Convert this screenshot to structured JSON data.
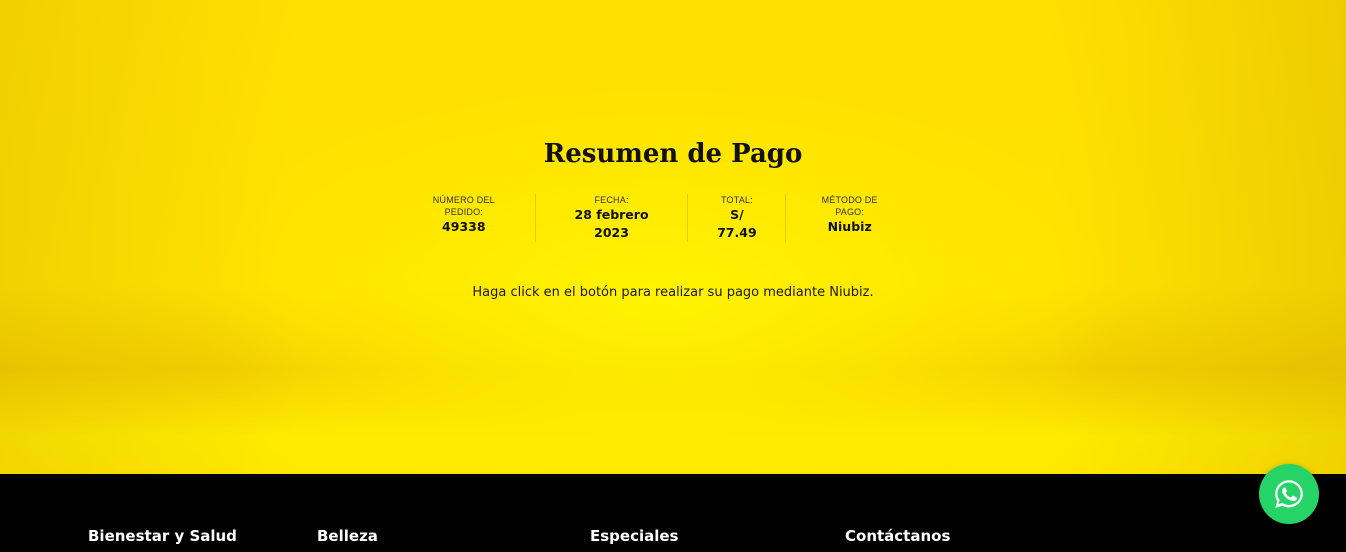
{
  "summary": {
    "title": "Resumen de Pago",
    "items": [
      {
        "label": "NÚMERO DEL PEDIDO:",
        "value": "49338"
      },
      {
        "label": "FECHA:",
        "value": "28 febrero 2023"
      },
      {
        "label": "TOTAL:",
        "value": "S/ 77.49"
      },
      {
        "label": "MÉTODO DE PAGO:",
        "value": "Niubiz"
      }
    ],
    "message": "Haga click en el botón para realizar su pago mediante Niubiz."
  },
  "footer": {
    "columns": [
      "Bienestar y Salud",
      "Belleza",
      "Especiales",
      "Contáctanos"
    ]
  },
  "whatsapp": {
    "icon": "whatsapp-icon",
    "color": "#25d366"
  },
  "colors": {
    "background": "#ffe000",
    "footer": "#000000"
  }
}
